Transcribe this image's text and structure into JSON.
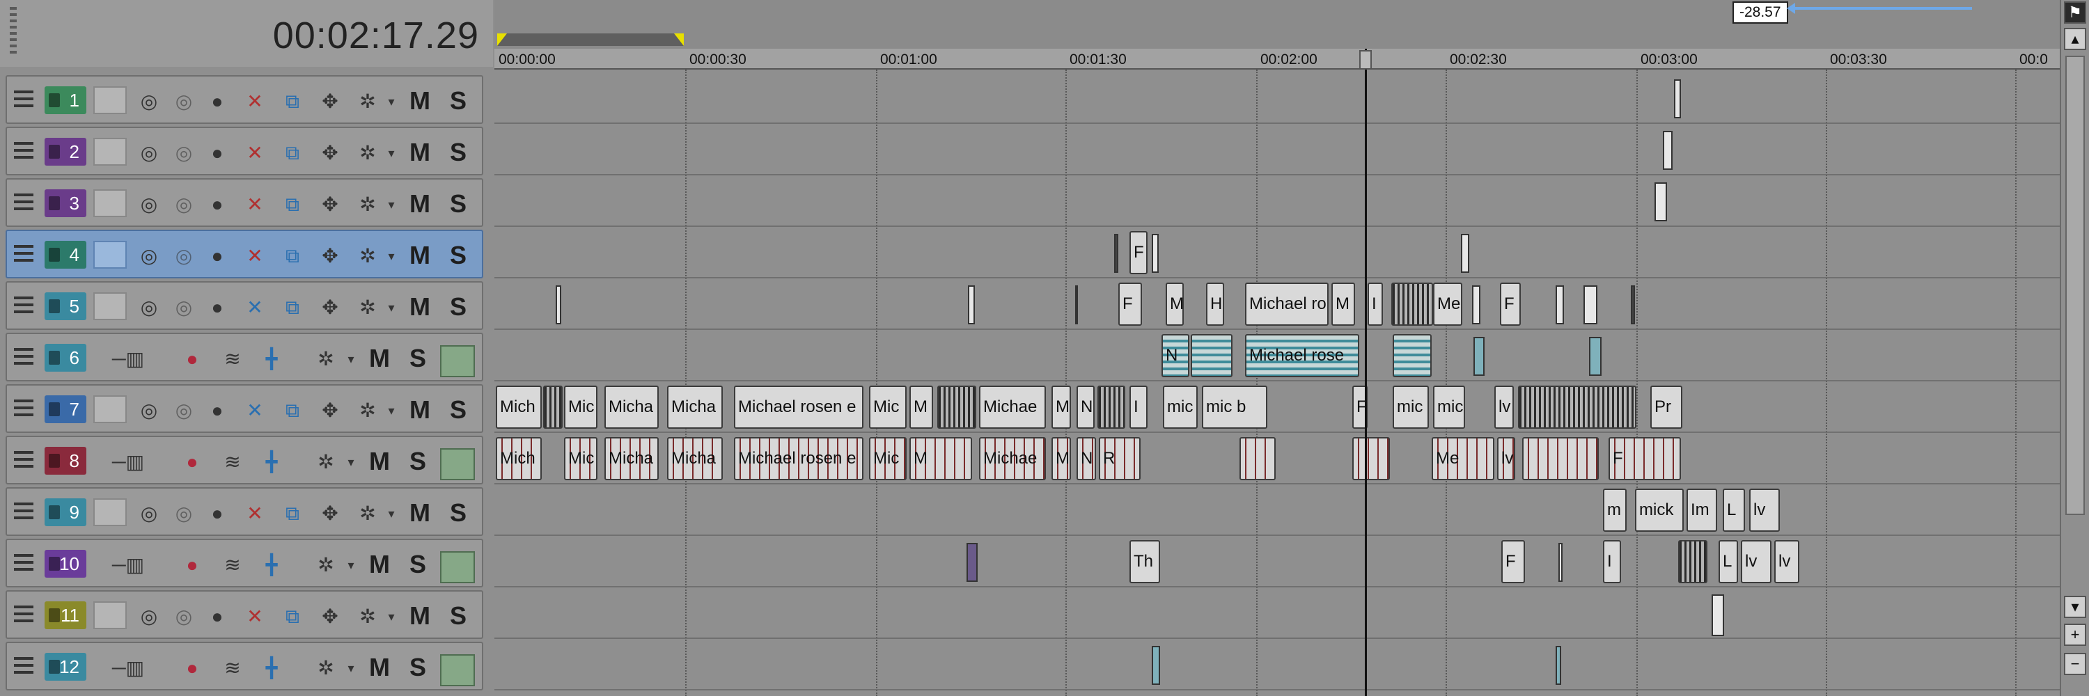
{
  "header": {
    "timecode": "00:02:17.29"
  },
  "tracks": [
    {
      "number": "1",
      "kind": "video",
      "color": "#3c8a5c",
      "selected": false
    },
    {
      "number": "2",
      "kind": "video",
      "color": "#6a3c8a",
      "selected": false
    },
    {
      "number": "3",
      "kind": "video",
      "color": "#6a3c8a",
      "selected": false
    },
    {
      "number": "4",
      "kind": "video",
      "color": "#2c7a6a",
      "selected": true
    },
    {
      "number": "5",
      "kind": "video",
      "color": "#3a8aa0",
      "selected": false
    },
    {
      "number": "6",
      "kind": "audio",
      "color": "#3a8aa0",
      "selected": false
    },
    {
      "number": "7",
      "kind": "video",
      "color": "#3a6aa8",
      "selected": false
    },
    {
      "number": "8",
      "kind": "audio",
      "color": "#8a2a3c",
      "selected": false
    },
    {
      "number": "9",
      "kind": "video",
      "color": "#3a8aa0",
      "selected": false
    },
    {
      "number": "10",
      "kind": "audio",
      "color": "#6a3c9a",
      "selected": false
    },
    {
      "number": "11",
      "kind": "video",
      "color": "#8a8a2a",
      "selected": false
    },
    {
      "number": "12",
      "kind": "audio",
      "color": "#3a8aa0",
      "selected": false
    }
  ],
  "controls": {
    "mute_label": "M",
    "solo_label": "S"
  },
  "ruler": {
    "labels": [
      "00:00:00",
      "00:00:30",
      "00:01:00",
      "00:01:30",
      "00:02:00",
      "00:02:30",
      "00:03:00",
      "00:03:30",
      "00:0"
    ]
  },
  "readout": "-28.57",
  "clips": {
    "track4": [
      "F"
    ],
    "track5": [
      "F",
      "M",
      "H",
      "Michael ro",
      "M",
      "I",
      "Me",
      "F"
    ],
    "track6": [
      "N",
      "Michael rose"
    ],
    "track7": [
      "Mich",
      "Mic",
      "Micha",
      "Micha",
      "Michael rosen e",
      "Mic",
      "M",
      "Michae",
      "M",
      "N",
      "I",
      "mic",
      "mic b",
      "F",
      "mic",
      "mic",
      "lv",
      "Pr"
    ],
    "track8": [
      "Mich",
      "Mic",
      "Micha",
      "Micha",
      "Michael rosen e",
      "Mic",
      "M",
      "Michae",
      "M",
      "N",
      "R",
      "Me",
      "lv",
      "F"
    ],
    "track9": [
      "m",
      "mick",
      "Im",
      "L",
      "lv"
    ],
    "track10": [
      "Th",
      "F",
      "I",
      "L",
      "lv",
      "lv"
    ]
  },
  "icons": {
    "hamburger": "menu-icon",
    "fx": "fx-icon",
    "composite": "composite-icon",
    "motion": "motion-icon",
    "crop": "pan-crop-icon",
    "split": "split-icon",
    "settings": "gear-icon",
    "record": "record-icon",
    "volume": "volume-slider-icon",
    "pan": "pan-icon"
  }
}
